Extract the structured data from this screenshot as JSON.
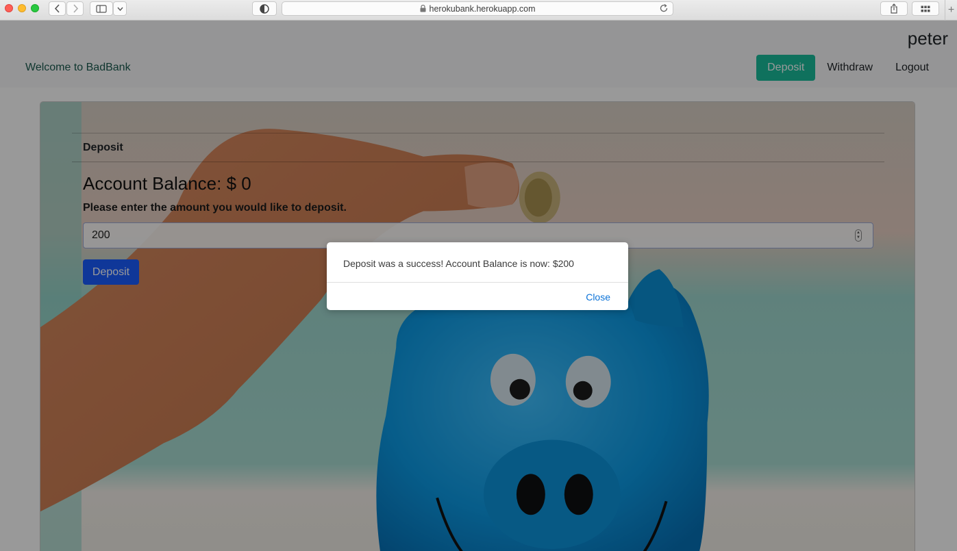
{
  "browser": {
    "url": "herokubank.herokuapp.com",
    "plus_tab": "+"
  },
  "navbar": {
    "username": "peter",
    "brand": "Welcome to BadBank",
    "links": [
      {
        "label": "Deposit",
        "active": true
      },
      {
        "label": "Withdraw",
        "active": false
      },
      {
        "label": "Logout",
        "active": false
      }
    ],
    "accent_color": "#1abc9c"
  },
  "card": {
    "header": "Deposit",
    "balance": "Account Balance: $ 0",
    "prompt": "Please enter the amount you would like to deposit.",
    "amount_value": "200",
    "submit_label": "Deposit",
    "submit_color": "#1a5cff",
    "background": "photo-hand-inserting-coin-into-blue-piggy-bank"
  },
  "modal": {
    "message": "Deposit was a success! Account Balance is now: $200",
    "close_label": "Close"
  }
}
